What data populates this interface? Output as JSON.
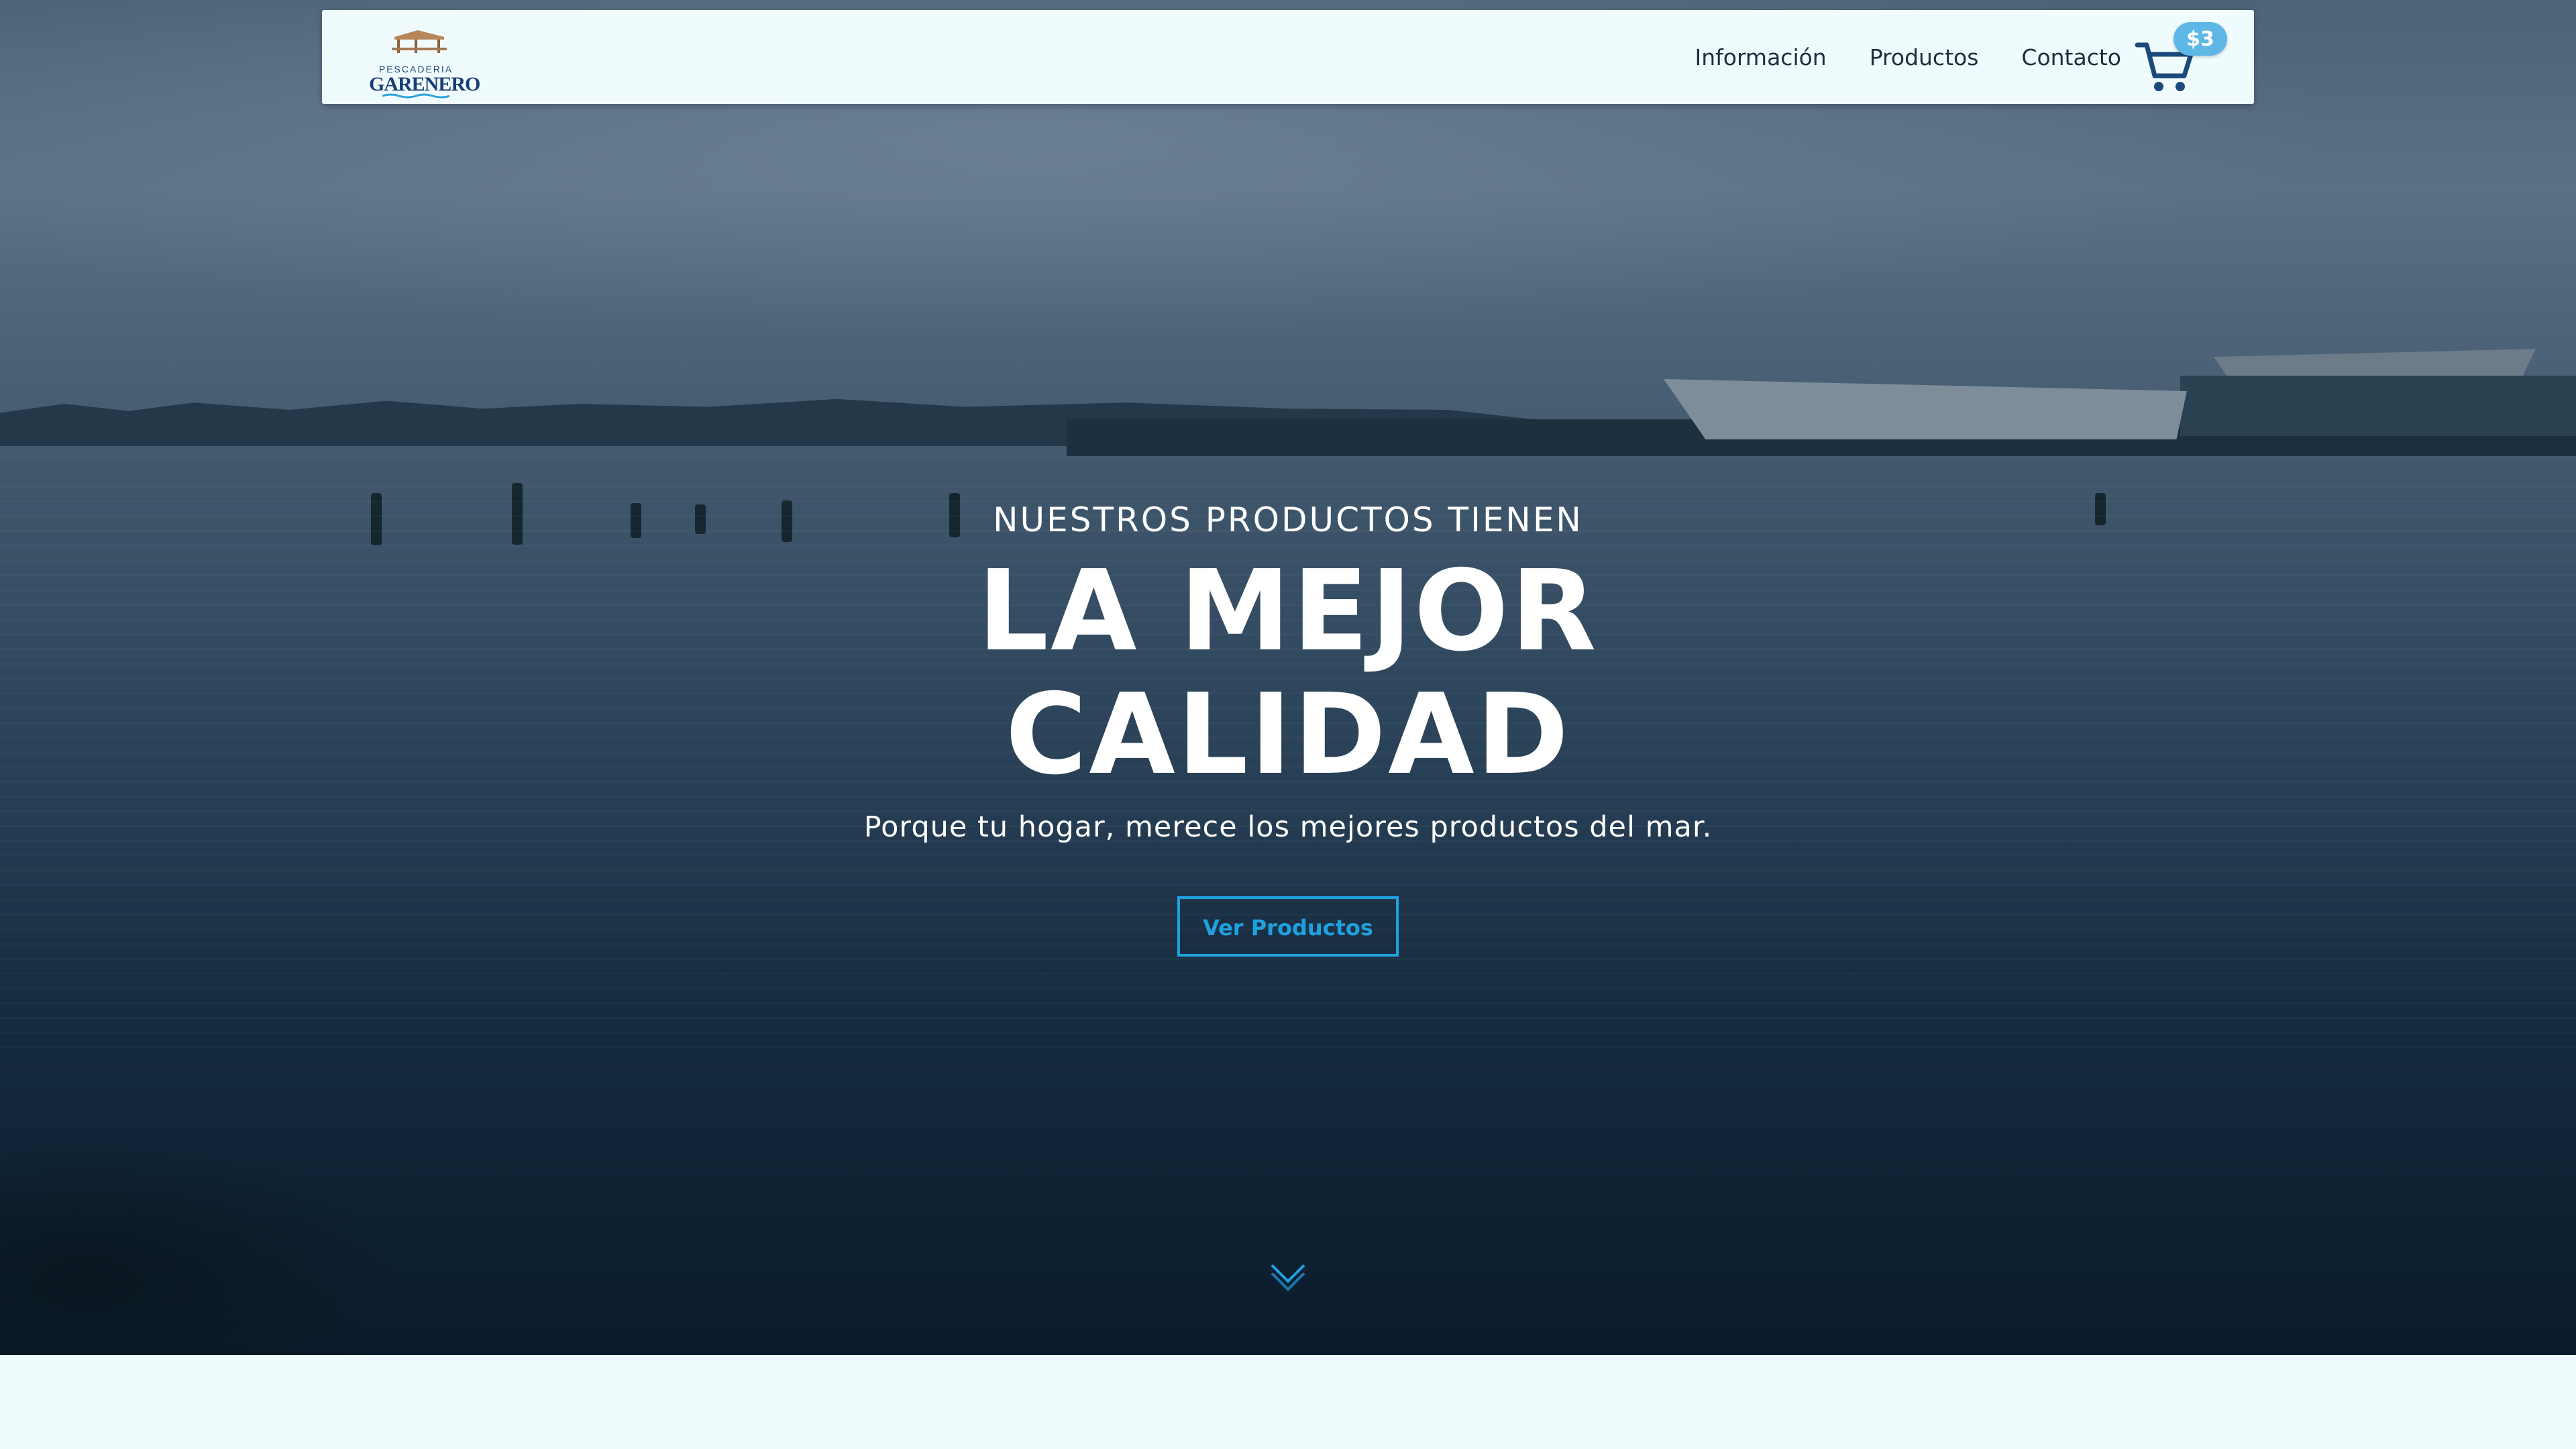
{
  "brand": {
    "logo_top": "PESCADERIA",
    "logo_name": "GARENERO"
  },
  "nav": {
    "items": [
      {
        "label": "Información"
      },
      {
        "label": "Productos"
      },
      {
        "label": "Contacto"
      }
    ],
    "cart_badge": "$3",
    "cart_icon": "shopping-cart-icon"
  },
  "hero": {
    "kicker": "NUESTROS PRODUCTOS TIENEN",
    "headline_line1": "LA MEJOR",
    "headline_line2": "CALIDAD",
    "subtitle": "Porque tu hogar, merece los mejores productos del mar.",
    "cta_label": "Ver Productos",
    "scroll_icon": "chevron-down-icon"
  },
  "colors": {
    "accent": "#1fa1df",
    "navbar_bg": "#f0fbfd",
    "badge": "#5fb7e6",
    "hero_overlay": "#0a1b2b"
  }
}
